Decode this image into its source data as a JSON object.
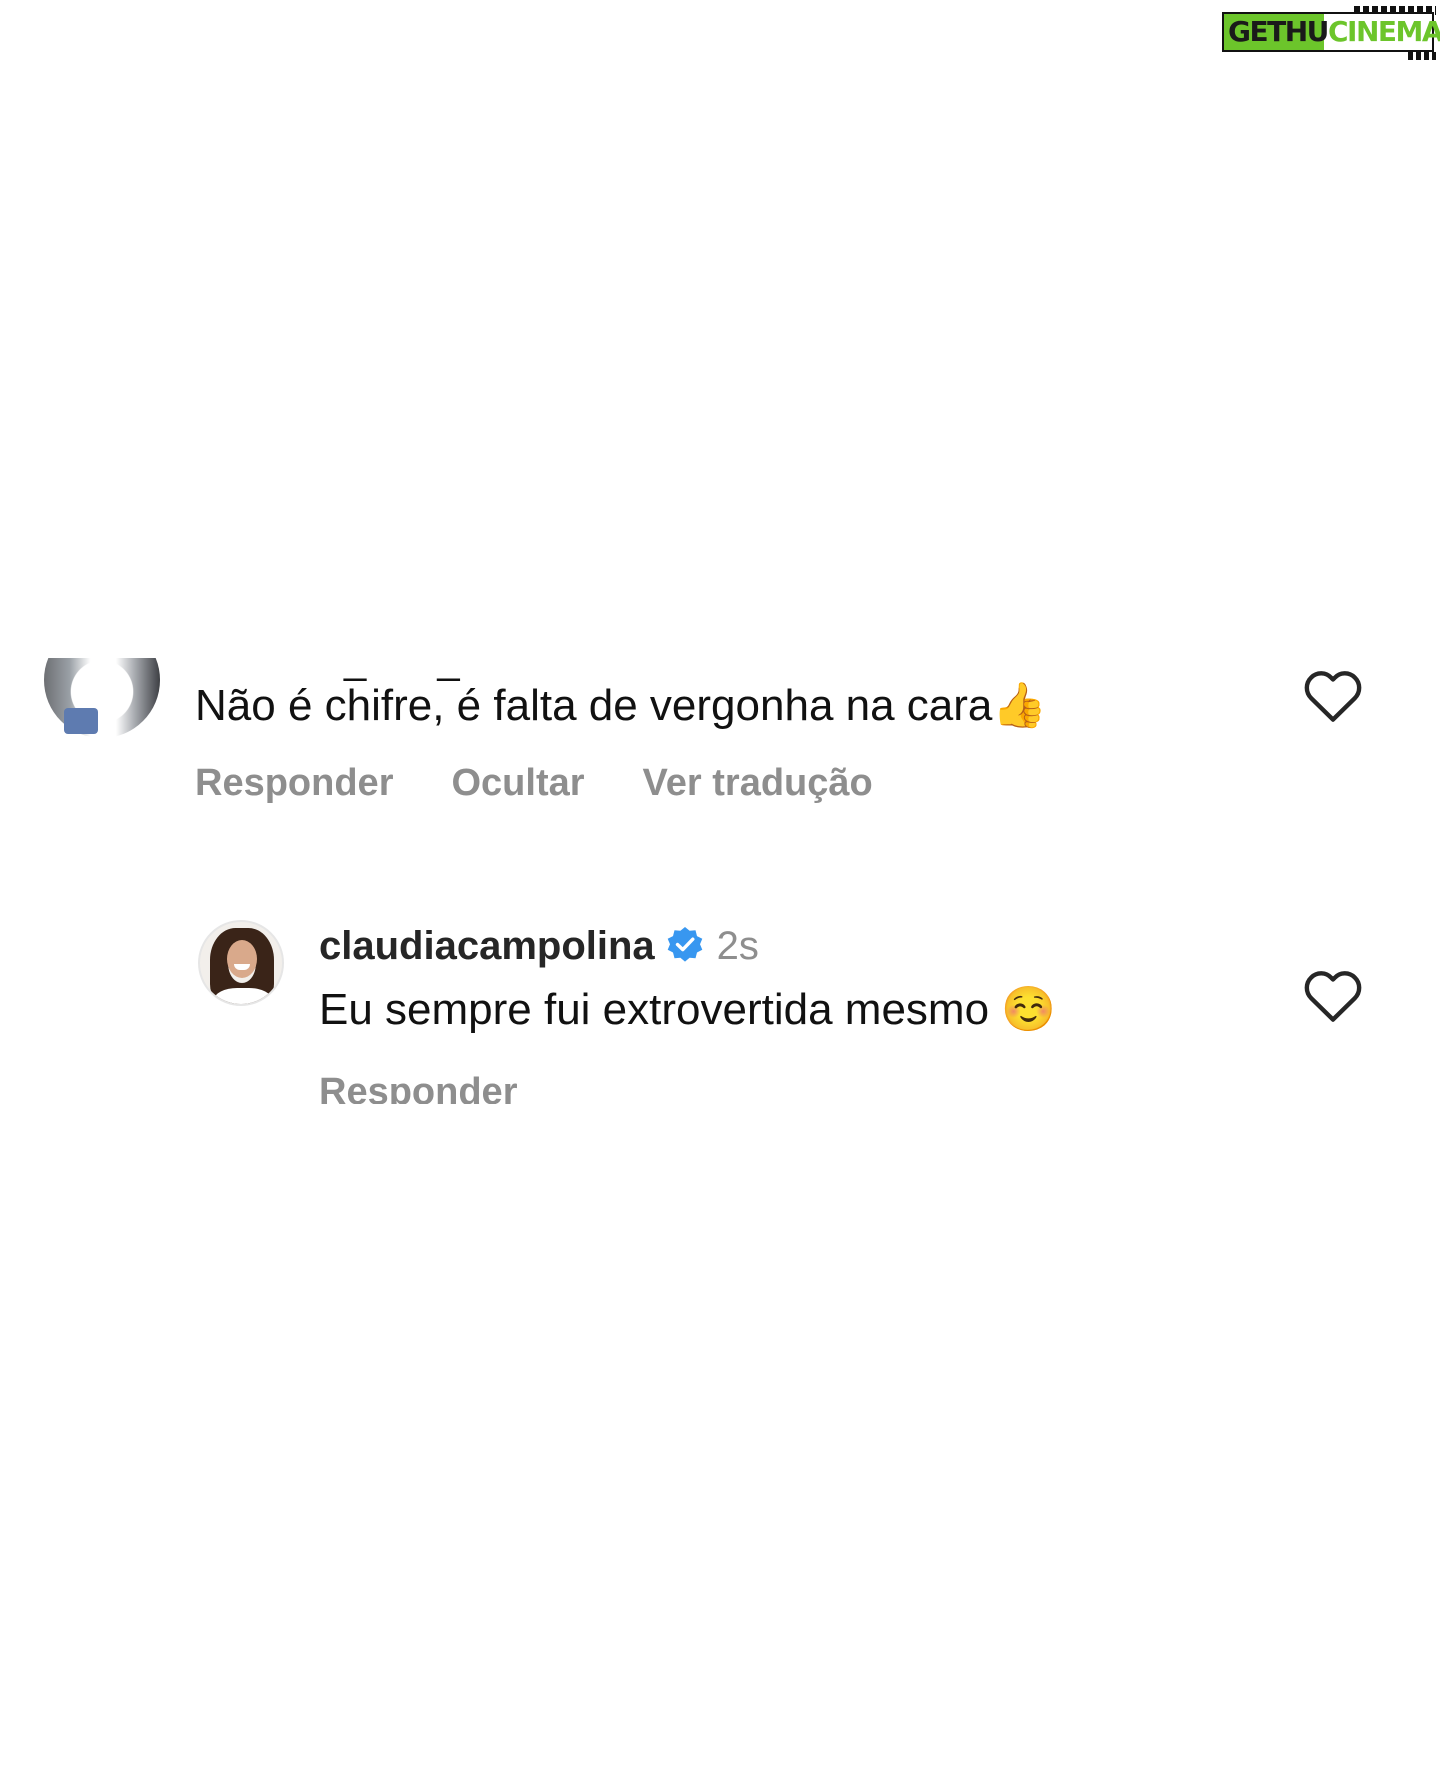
{
  "watermark": {
    "part1": "GETHU",
    "part2": "CINEMA",
    "colors": {
      "green": "#6cc52b",
      "dark": "#1a1a1a"
    }
  },
  "comment": {
    "author_fragment": "_ _",
    "text": "Não é chifre, é falta de vergonha na cara",
    "emoji": "👍",
    "actions": {
      "reply": "Responder",
      "hide": "Ocultar",
      "translate": "Ver tradução"
    },
    "like_icon": "heart-outline-icon"
  },
  "reply": {
    "username": "claudiacampolina",
    "verified_icon": "verified-badge-icon",
    "time": "2s",
    "text": "Eu sempre fui extrovertida mesmo",
    "emoji": "☺️",
    "action_reply": "Responder",
    "like_icon": "heart-outline-icon"
  },
  "colors": {
    "text": "#111111",
    "muted": "#8e8e8e",
    "verified": "#3897f0",
    "background": "#ffffff"
  }
}
